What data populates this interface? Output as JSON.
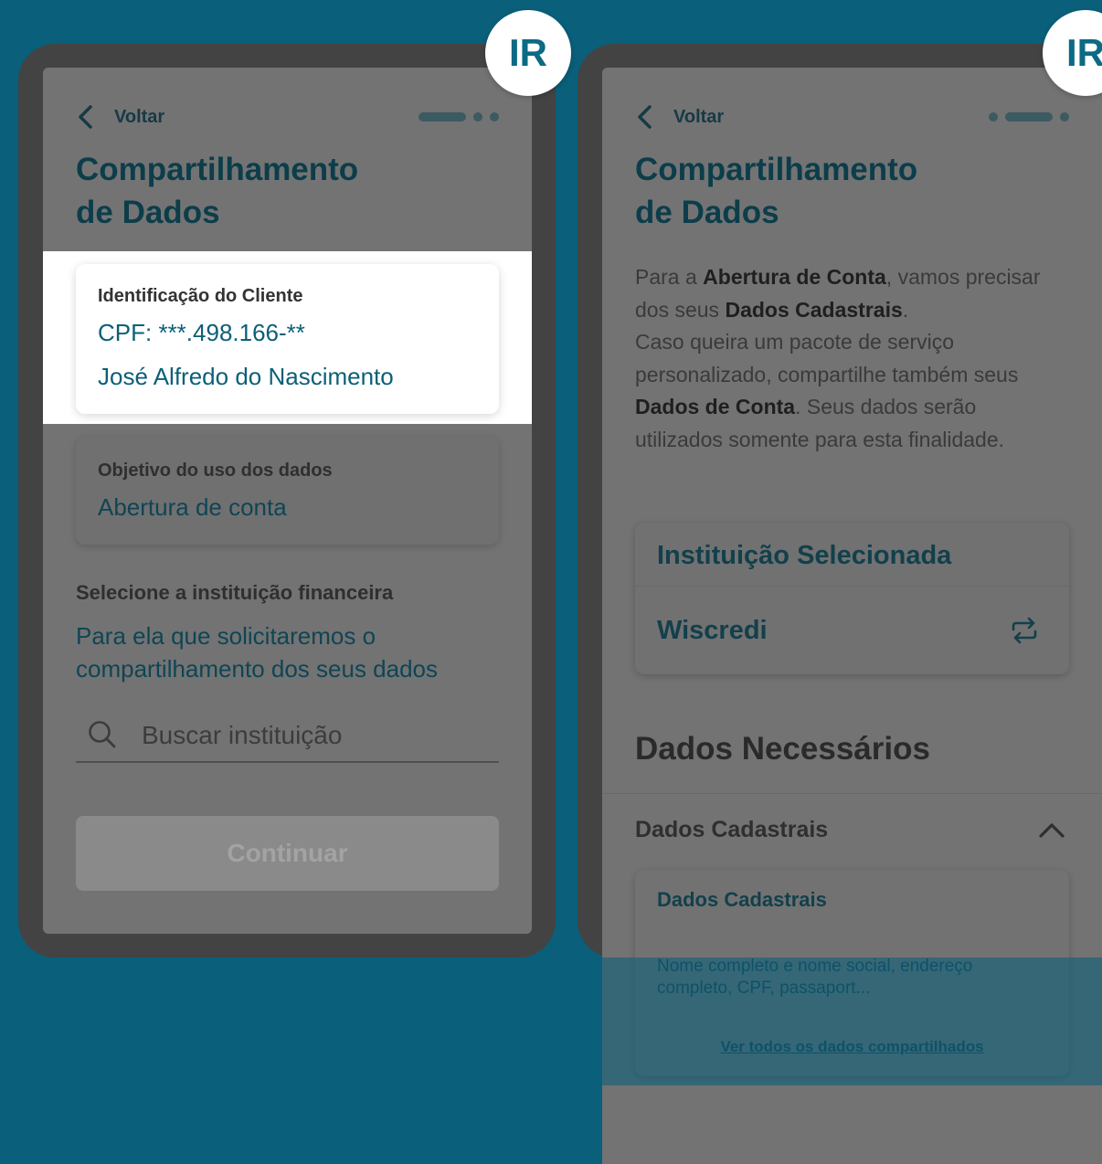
{
  "common": {
    "back_label": "Voltar",
    "title_line1": "Compartilhamento",
    "title_line2": "de Dados",
    "badge_text": "IR"
  },
  "colors": {
    "background": "#0a5f7a",
    "phone_frame": "#434343",
    "screen_dim": "#737373",
    "accent_text": "#0b5f78"
  },
  "screen1": {
    "step": {
      "total": 3,
      "active": 1
    },
    "client_card": {
      "label": "Identificação do Cliente",
      "cpf": "CPF: ***.498.166-**",
      "name": "José Alfredo do Nascimento"
    },
    "purpose_card": {
      "label": "Objetivo do uso dos dados",
      "value": "Abertura de conta"
    },
    "select_title": "Selecione a instituição financeira",
    "select_subtitle": "Para ela que solicitaremos o compartilhamento dos seus dados",
    "search": {
      "placeholder": "Buscar instituição",
      "value": ""
    },
    "continue_label": "Continuar"
  },
  "screen2": {
    "step": {
      "total": 3,
      "active": 2
    },
    "intro": {
      "p1": "Para a ",
      "p1_bold": "Abertura de Conta",
      "p2": ", vamos precisar dos seus ",
      "p2_bold": "Dados Cadastrais",
      "p3": ".",
      "p4": "Caso queira um pacote de serviço personalizado, compartilhe também seus ",
      "p4_bold": "Dados de Conta",
      "p5": ". Seus dados serão utilizados somente para esta finalidade."
    },
    "institution_card": {
      "title": "Instituição Selecionada",
      "name": "Wiscredi"
    },
    "required_title": "Dados Necessários",
    "accordion": {
      "header": "Dados Cadastrais",
      "card_title": "Dados Cadastrais",
      "card_desc": "Nome completo e nome social, endereço completo, CPF, passaport...",
      "link": "Ver todos os dados compartilhados"
    }
  }
}
